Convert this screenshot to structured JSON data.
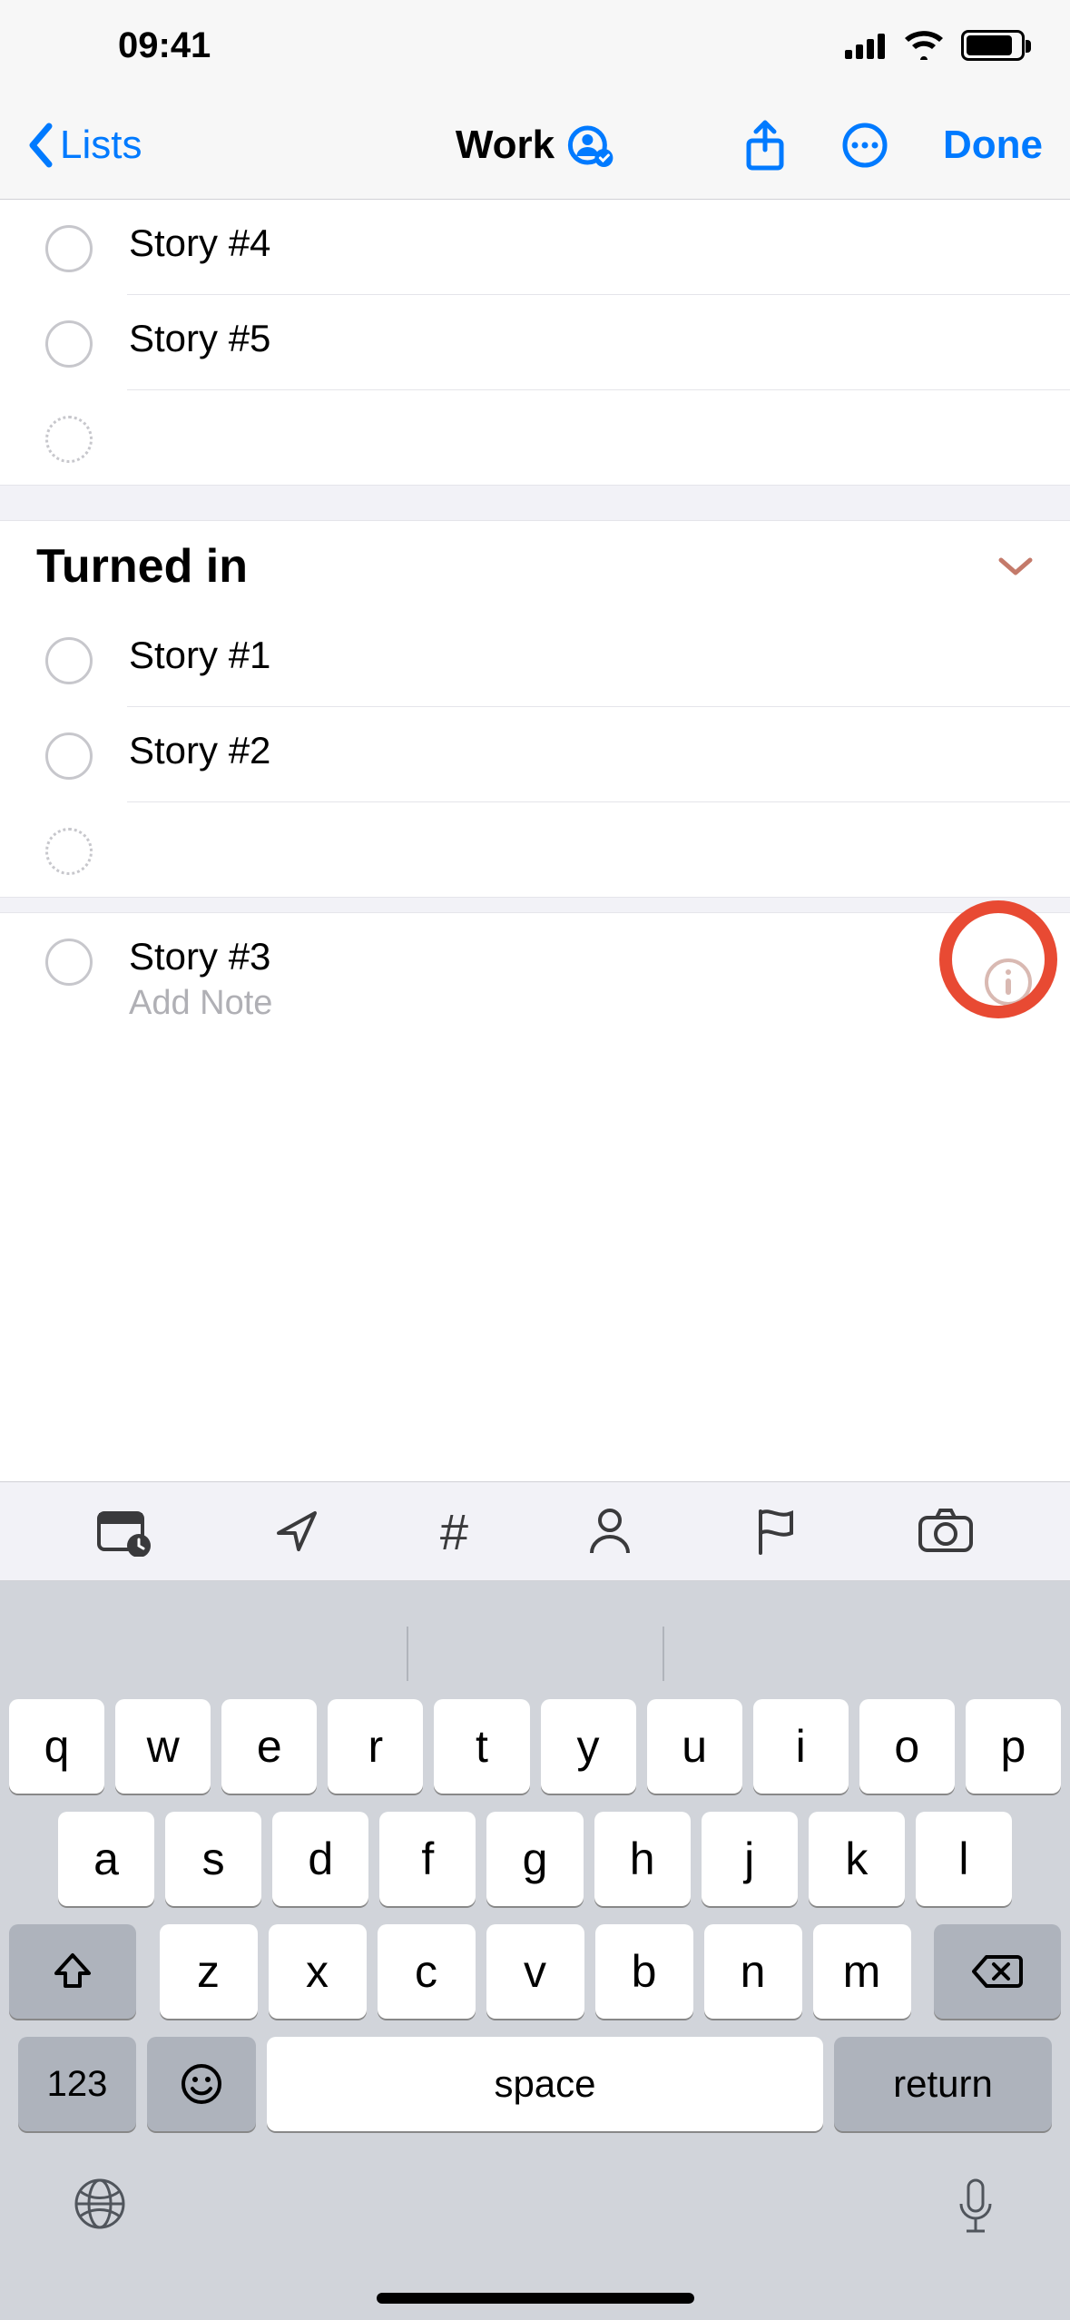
{
  "status": {
    "time": "09:41"
  },
  "nav": {
    "back_label": "Lists",
    "title": "Work",
    "done_label": "Done"
  },
  "top_reminders": [
    {
      "title": "Story #4"
    },
    {
      "title": "Story #5"
    }
  ],
  "section": {
    "title": "Turned in"
  },
  "section_reminders": [
    {
      "title": "Story #1"
    },
    {
      "title": "Story #2"
    }
  ],
  "editing": {
    "title": "Story #3",
    "note_placeholder": "Add Note"
  },
  "toolbar": {
    "hash": "#"
  },
  "keyboard": {
    "row1": [
      "q",
      "w",
      "e",
      "r",
      "t",
      "y",
      "u",
      "i",
      "o",
      "p"
    ],
    "row2": [
      "a",
      "s",
      "d",
      "f",
      "g",
      "h",
      "j",
      "k",
      "l"
    ],
    "row3": [
      "z",
      "x",
      "c",
      "v",
      "b",
      "n",
      "m"
    ],
    "num_label": "123",
    "space_label": "space",
    "return_label": "return"
  }
}
